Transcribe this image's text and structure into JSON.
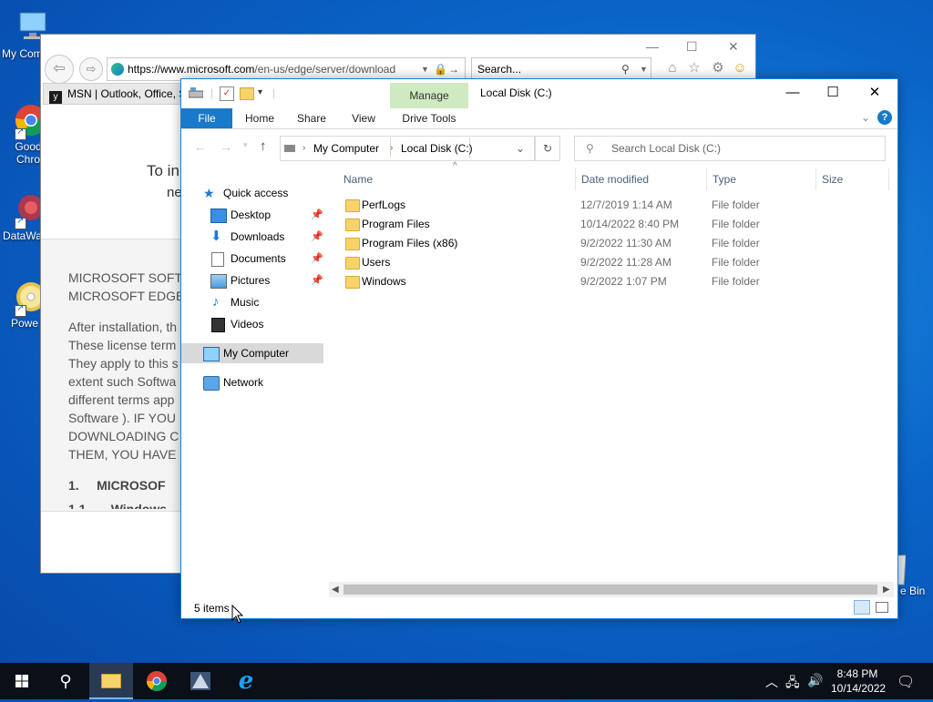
{
  "desktop": {
    "icons": [
      {
        "label": "My Com",
        "name": "my-computer"
      },
      {
        "label": "Good Chro",
        "name": "google-chrome"
      },
      {
        "label": "DataWa",
        "name": "datawatch"
      },
      {
        "label": "Powe",
        "name": "power"
      },
      {
        "label": "e Bin",
        "name": "recycle-bin"
      }
    ]
  },
  "ie": {
    "url_host": "https://www.microsoft.com",
    "url_path": "/en-us/edge/server/download",
    "search_placeholder": "Search...",
    "tab_label": "MSN | Outlook, Office, S",
    "page_text_1": "To in",
    "page_text_2": "ne",
    "license_lines": [
      "MICROSOFT SOFTW",
      "MICROSOFT EDGE",
      "After installation, th",
      "These license term",
      "They apply to this s",
      "extent such Softwa",
      "different terms app",
      "Software ). IF YOU",
      "DOWNLOADING C",
      "THEM, YOU HAVE",
      "1.     MICROSOF",
      "1.1       Windows"
    ]
  },
  "explorer": {
    "title": "Local Disk (C:)",
    "manage_label": "Manage",
    "tabs": [
      "File",
      "Home",
      "Share",
      "View",
      "Drive Tools"
    ],
    "breadcrumb": [
      "My Computer",
      "Local Disk (C:)"
    ],
    "search_placeholder": "Search Local Disk (C:)",
    "nav": [
      {
        "label": "Quick access"
      },
      {
        "label": "Desktop"
      },
      {
        "label": "Downloads"
      },
      {
        "label": "Documents"
      },
      {
        "label": "Pictures"
      },
      {
        "label": "Music"
      },
      {
        "label": "Videos"
      },
      {
        "label": "My Computer"
      },
      {
        "label": "Network"
      }
    ],
    "columns": [
      "Name",
      "Date modified",
      "Type",
      "Size"
    ],
    "files": [
      {
        "name": "PerfLogs",
        "date": "12/7/2019 1:14 AM",
        "type": "File folder"
      },
      {
        "name": "Program Files",
        "date": "10/14/2022 8:40 PM",
        "type": "File folder"
      },
      {
        "name": "Program Files (x86)",
        "date": "9/2/2022 11:30 AM",
        "type": "File folder"
      },
      {
        "name": "Users",
        "date": "9/2/2022 11:28 AM",
        "type": "File folder"
      },
      {
        "name": "Windows",
        "date": "9/2/2022 1:07 PM",
        "type": "File folder"
      }
    ],
    "status": "5 items"
  },
  "taskbar": {
    "time": "8:48 PM",
    "date": "10/14/2022"
  }
}
